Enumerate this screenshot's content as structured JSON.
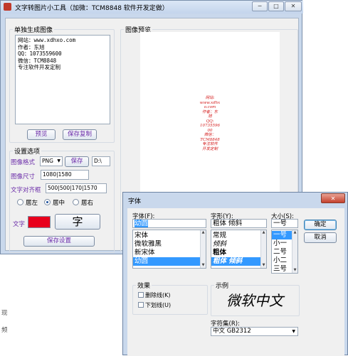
{
  "window": {
    "title": "文字转图片小工具（加微：TCM8848 软件开发定做）",
    "minimize": "─",
    "maximize": "□",
    "close": "✕"
  },
  "single": {
    "legend": "单独生成图像",
    "text_lines": [
      "网站：www.xdhxo.com",
      "作者：东旭",
      "QQ：1073559600",
      "微信：TCM8848",
      "专注软件开发定制"
    ],
    "preview_button": "预览",
    "save_copy_button": "保存复制"
  },
  "settings": {
    "legend": "设置选项",
    "format_label": "图像格式",
    "format_value": "PNG",
    "save_button": "保存",
    "path_value": "D:\\",
    "size_label": "图像尺寸",
    "size_value": "1080|1580",
    "align_label": "文字对齐框",
    "align_value": "500|500|170|1570",
    "radio_left": "居左",
    "radio_center": "居中",
    "radio_right": "居右",
    "text_label": "文字",
    "font_button": "字",
    "save_settings_button": "保存设置"
  },
  "preview": {
    "legend": "图像预览",
    "lines": [
      "网站:",
      "www.xdhx",
      "o.com",
      "作者：东",
      "旭",
      "QQ:",
      "10735596",
      "00",
      "微信：",
      "TCM8848",
      "专注软件",
      "开发定制"
    ]
  },
  "background": {
    "side_texts": [
      "现",
      "频"
    ]
  },
  "font_dialog": {
    "title": "字体",
    "close": "✕",
    "font_label": "字体(F):",
    "font_value": "幼圆",
    "fonts": [
      "宋体",
      "微软雅黑",
      "新宋体",
      "幼圆"
    ],
    "style_label": "字形(Y):",
    "style_value": "粗体 倾斜",
    "styles": [
      "常规",
      "倾斜",
      "粗体",
      "粗体 倾斜"
    ],
    "size_label": "大小(S):",
    "size_value": "一号",
    "sizes": [
      "一号",
      "小一",
      "二号",
      "小二",
      "三号"
    ],
    "ok_button": "确定",
    "cancel_button": "取消",
    "effects_legend": "效果",
    "strikeout_label": "删除线(K)",
    "underline_label": "下划线(U)",
    "sample_legend": "示例",
    "sample_text": "微软中文",
    "charset_label": "字符集(R):",
    "charset_value": "中文 GB2312"
  }
}
